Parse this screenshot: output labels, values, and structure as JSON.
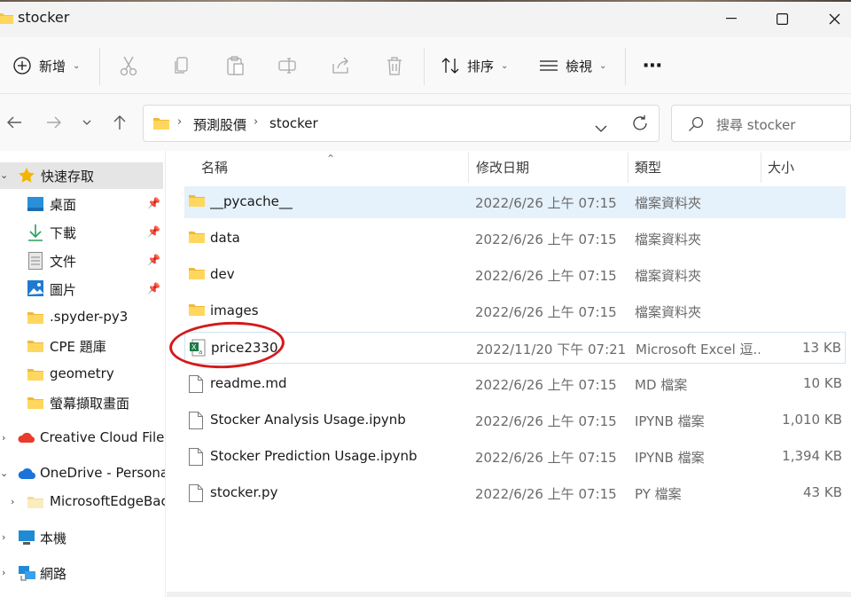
{
  "window": {
    "title": "stocker",
    "controls": {
      "minimize": "–",
      "maximize": "☐",
      "close": "✕"
    }
  },
  "toolbar": {
    "new_label": "新增",
    "sort_label": "排序",
    "view_label": "檢視",
    "more_label": "⋯"
  },
  "address": {
    "crumbs": [
      "預測股價",
      "stocker"
    ],
    "search_placeholder": "搜尋 stocker"
  },
  "sidebar": {
    "quick_access": "快速存取",
    "pinned": [
      {
        "label": "桌面",
        "icon": "desktop-icon"
      },
      {
        "label": "下載",
        "icon": "download-icon"
      },
      {
        "label": "文件",
        "icon": "document-icon"
      },
      {
        "label": "圖片",
        "icon": "pictures-icon"
      }
    ],
    "folders": [
      ".spyder-py3",
      "CPE 題庫",
      "geometry",
      "螢幕擷取畫面"
    ],
    "creative_cloud": "Creative Cloud Files",
    "onedrive": "OneDrive - Personal",
    "onedrive_child": "MicrosoftEdgeBackups",
    "this_pc": "本機",
    "network": "網路"
  },
  "columns": {
    "name": "名稱",
    "date": "修改日期",
    "type": "類型",
    "size": "大小"
  },
  "files": [
    {
      "name": "__pycache__",
      "date": "2022/6/26 上午 07:15",
      "type": "檔案資料夾",
      "size": "",
      "icon": "folder-icon"
    },
    {
      "name": "data",
      "date": "2022/6/26 上午 07:15",
      "type": "檔案資料夾",
      "size": "",
      "icon": "folder-icon"
    },
    {
      "name": "dev",
      "date": "2022/6/26 上午 07:15",
      "type": "檔案資料夾",
      "size": "",
      "icon": "folder-icon"
    },
    {
      "name": "images",
      "date": "2022/6/26 上午 07:15",
      "type": "檔案資料夾",
      "size": "",
      "icon": "folder-icon"
    },
    {
      "name": "price2330",
      "date": "2022/11/20 下午 07:21",
      "type": "Microsoft Excel 逗...",
      "size": "13 KB",
      "icon": "excel-icon"
    },
    {
      "name": "readme.md",
      "date": "2022/6/26 上午 07:15",
      "type": "MD 檔案",
      "size": "10 KB",
      "icon": "file-icon"
    },
    {
      "name": "Stocker Analysis Usage.ipynb",
      "date": "2022/6/26 上午 07:15",
      "type": "IPYNB 檔案",
      "size": "1,010 KB",
      "icon": "file-icon"
    },
    {
      "name": "Stocker Prediction Usage.ipynb",
      "date": "2022/6/26 上午 07:15",
      "type": "IPYNB 檔案",
      "size": "1,394 KB",
      "icon": "file-icon"
    },
    {
      "name": "stocker.py",
      "date": "2022/6/26 上午 07:15",
      "type": "PY 檔案",
      "size": "43 KB",
      "icon": "file-icon"
    }
  ],
  "colors": {
    "accent": "#0067c0",
    "folder": "#f4c542",
    "annotation": "#d41a1a",
    "selection": "#e5f1fb"
  }
}
